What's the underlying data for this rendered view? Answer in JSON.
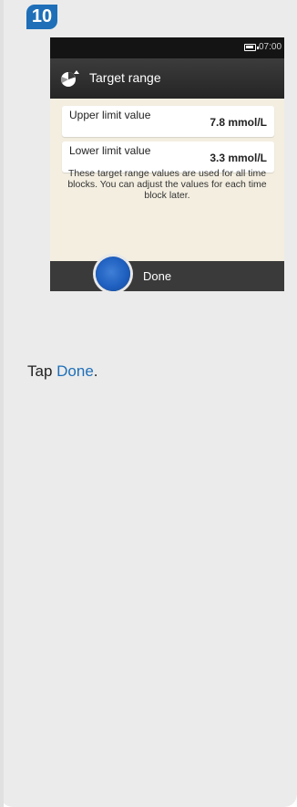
{
  "step": {
    "number": "10"
  },
  "device": {
    "clock": "07:00",
    "title": "Target range",
    "rows": [
      {
        "label": "Upper limit value",
        "value": "7.8 mmol/L"
      },
      {
        "label": "Lower limit value",
        "value": "3.3 mmol/L"
      }
    ],
    "info": "These target range values are used for all time blocks. You can adjust the values for each time block later.",
    "done_label": "Done"
  },
  "instruction": {
    "prefix": "Tap ",
    "link": "Done",
    "suffix": "."
  },
  "colors": {
    "accent": "#1e6fb8",
    "card_bg": "#ebebeb",
    "screen_bg": "#f3eee0"
  }
}
